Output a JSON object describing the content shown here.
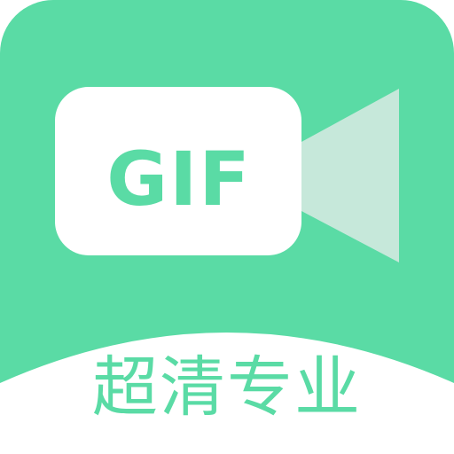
{
  "icon": {
    "badge_text": "GIF",
    "tagline": "超清专业",
    "colors": {
      "background_green": "#5adba5",
      "lens_green": "#c6e8da",
      "white": "#ffffff"
    },
    "icon_names": [
      "video-camera-icon"
    ]
  }
}
